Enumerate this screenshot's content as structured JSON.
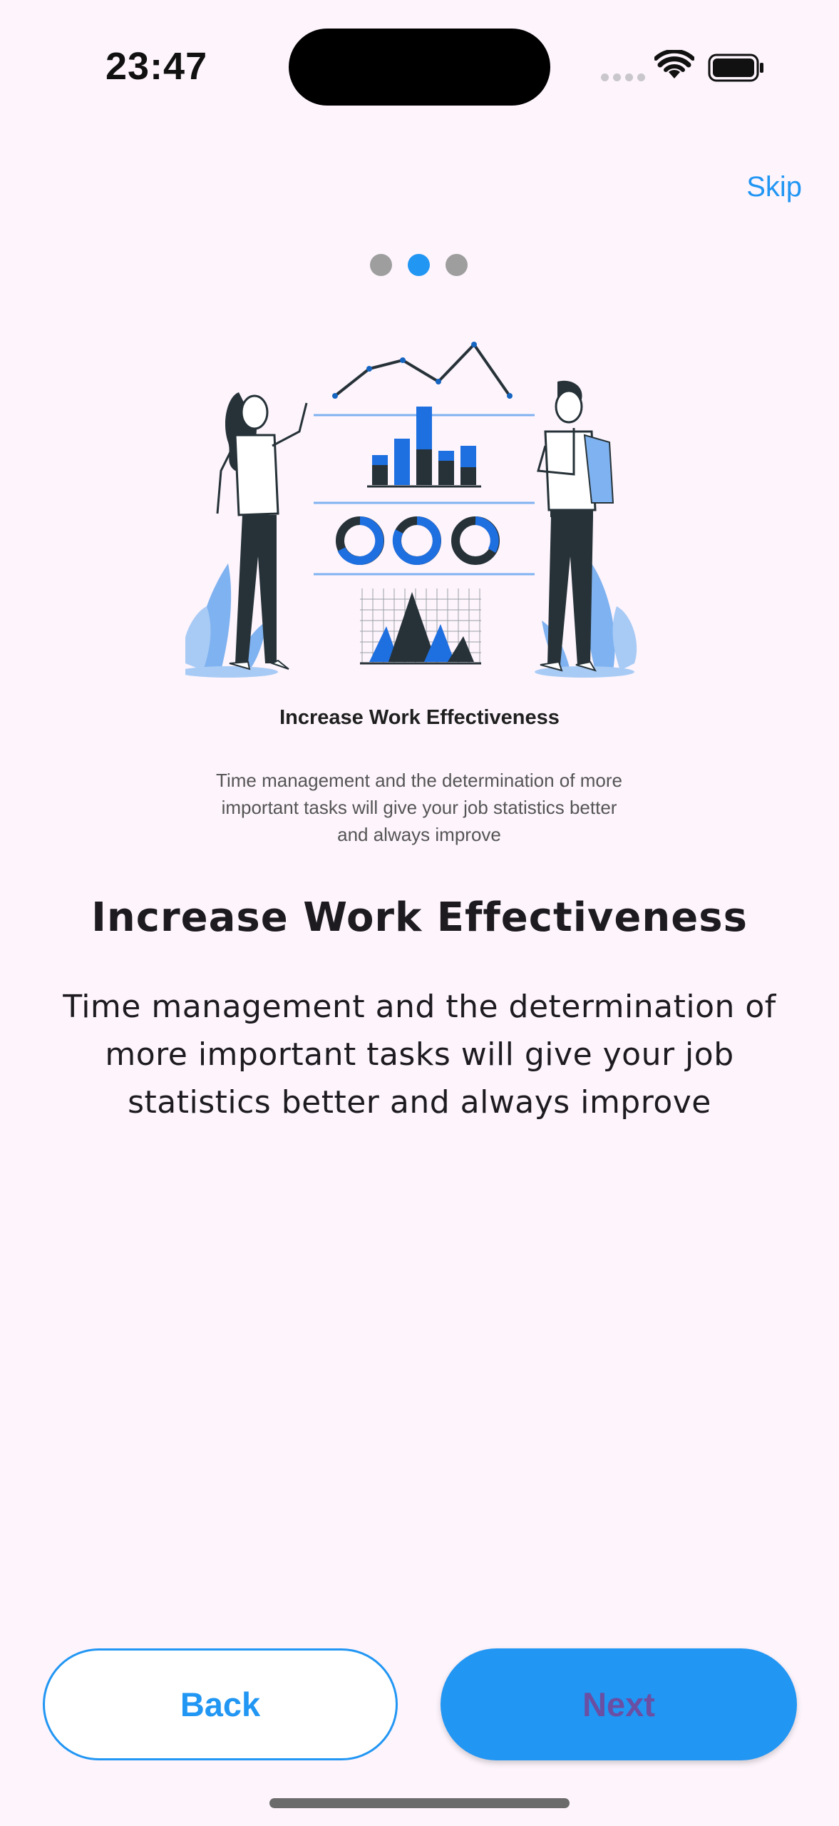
{
  "status_bar": {
    "time": "23:47"
  },
  "header": {
    "skip_label": "Skip"
  },
  "pager": {
    "total_pages": 3,
    "active_page": 2
  },
  "illustration": {
    "title": "Increase Work Effectiveness",
    "body": "Time management and the determination of more important tasks will give your job statistics better and always improve"
  },
  "content": {
    "title": "Increase Work Effectiveness",
    "description": "Time management and the determination of more important tasks will give your job statistics better and always improve"
  },
  "actions": {
    "back_label": "Back",
    "next_label": "Next"
  },
  "colors": {
    "accent": "#2196F3",
    "background": "#fdf4fc",
    "next_text": "#6a4fa3",
    "inactive_dot": "#9e9e9e"
  }
}
